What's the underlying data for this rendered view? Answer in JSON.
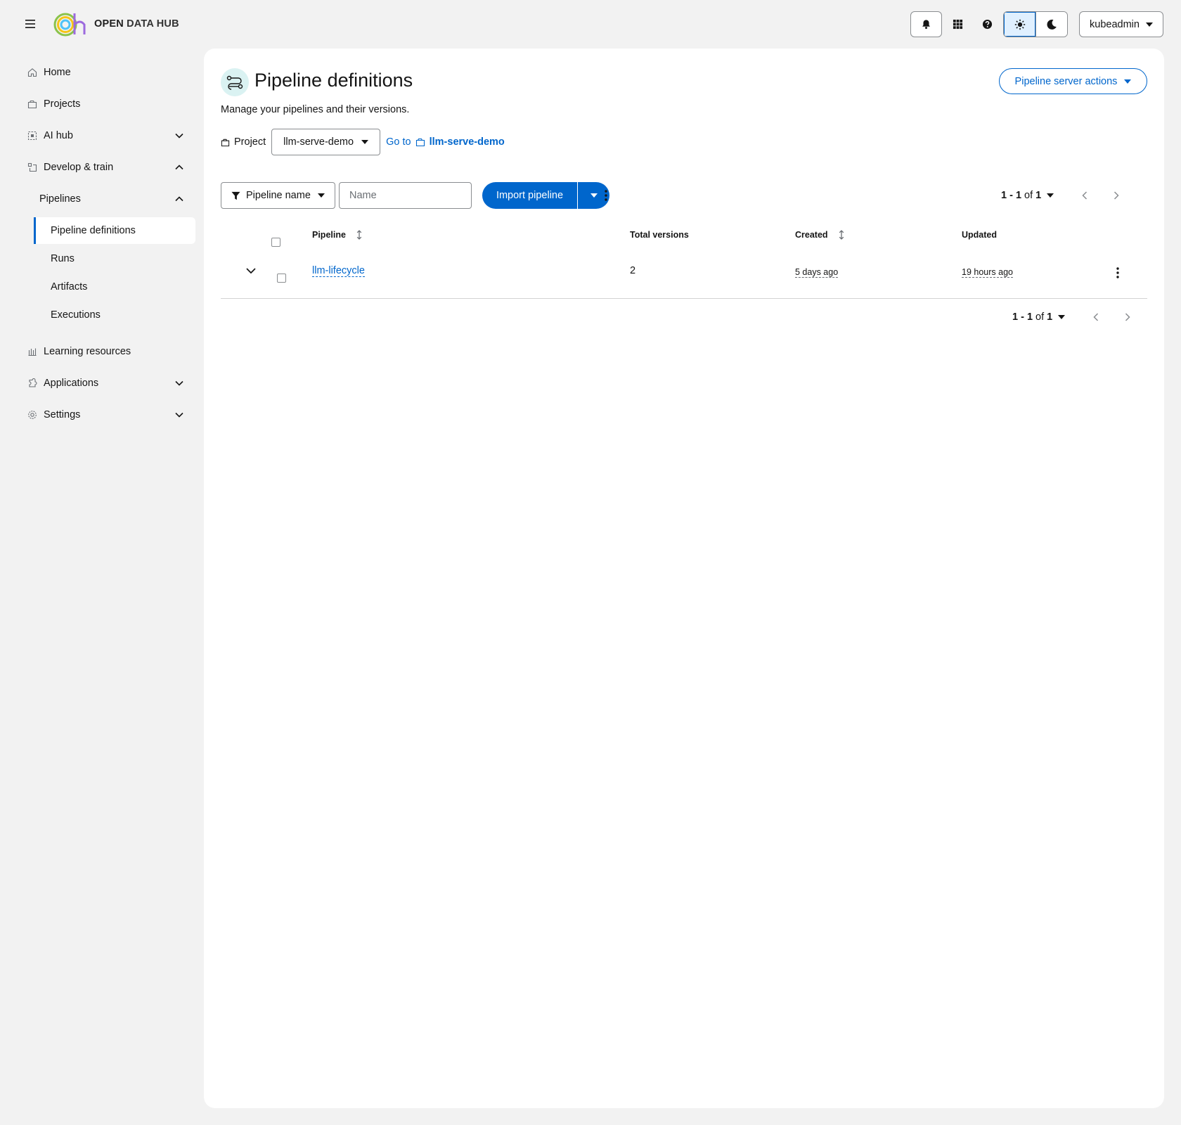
{
  "masthead": {
    "brand_bold": "OPEN",
    "brand_rest": " DATA HUB",
    "user": "kubeadmin",
    "icons": [
      "hamburger-icon",
      "bell-icon",
      "app-grid-icon",
      "help-icon",
      "sun-icon",
      "moon-icon"
    ]
  },
  "sidebar": {
    "items": [
      {
        "label": "Home",
        "icon": "home-icon"
      },
      {
        "label": "Projects",
        "icon": "projects-icon"
      },
      {
        "label": "AI hub",
        "icon": "ai-hub-icon",
        "expandable": true
      },
      {
        "label": "Develop & train",
        "icon": "develop-icon",
        "expanded": true
      },
      {
        "label": "Learning resources",
        "icon": "learning-icon"
      },
      {
        "label": "Applications",
        "icon": "applications-icon",
        "expandable": true
      },
      {
        "label": "Settings",
        "icon": "settings-icon",
        "expandable": true
      }
    ],
    "pipelines_label": "Pipelines",
    "pipeline_children": [
      "Pipeline definitions",
      "Runs",
      "Artifacts",
      "Executions"
    ],
    "active": "Pipeline definitions"
  },
  "page": {
    "title": "Pipeline definitions",
    "description": "Manage your pipelines and their versions.",
    "server_actions": "Pipeline server actions",
    "project_label": "Project",
    "project_value": "llm-serve-demo",
    "goto_label": "Go to",
    "goto_project": "llm-serve-demo"
  },
  "toolbar": {
    "filter_label": "Pipeline name",
    "name_placeholder": "Name",
    "import_label": "Import pipeline"
  },
  "pagination": {
    "range": "1 - 1",
    "of_label": "of",
    "total": "1"
  },
  "table": {
    "columns": [
      "Pipeline",
      "Total versions",
      "Created",
      "Updated"
    ],
    "rows": [
      {
        "pipeline": "llm-lifecycle",
        "total_versions": "2",
        "created": "5 days ago",
        "updated": "19 hours ago"
      }
    ]
  },
  "colors": {
    "accent": "#0066cc",
    "active_nav_border": "#0066cc",
    "page_icon_bg": "#daf2f2"
  }
}
